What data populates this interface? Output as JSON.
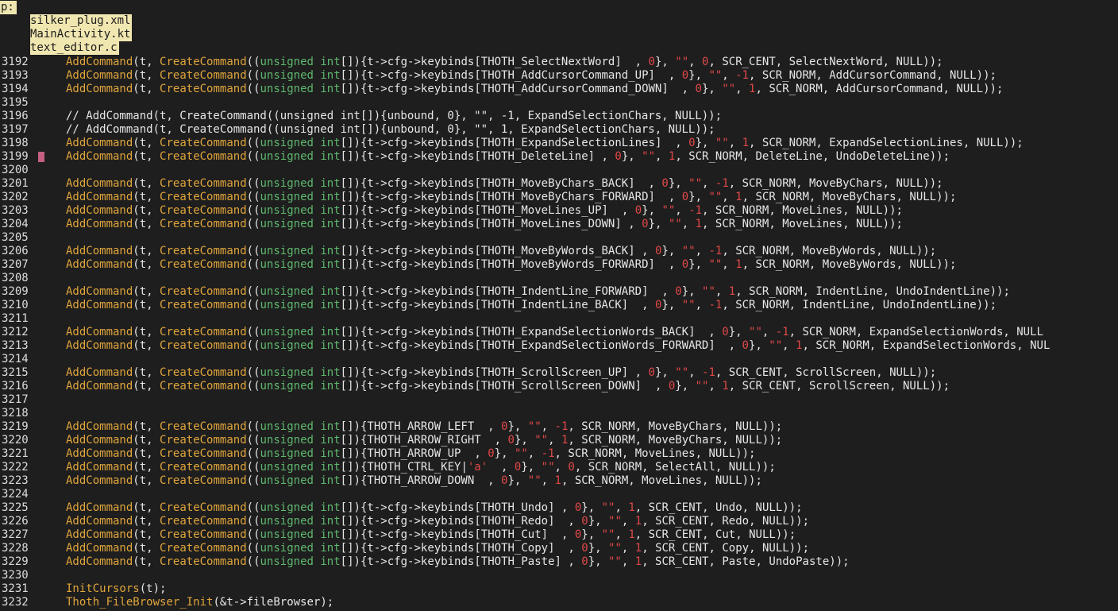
{
  "prompt": {
    "label": "p:"
  },
  "suggestions": [
    "silker_plug.xml",
    "MainActivity.kt",
    "text_editor.c"
  ],
  "colors": {
    "background": "#1e1e1e",
    "text": "#e6e6e6",
    "function": "#e0a53c",
    "type": "#5fb86e",
    "number": "#e04848",
    "suggestion_bg": "#f0e6b0",
    "line_marker": "#c46083"
  },
  "lines": [
    {
      "num": "3192",
      "code": "AddCommand(t, CreateCommand((unsigned int[]){t->cfg->keybinds[THOTH_SelectNextWord]  , 0}, \"\", 0, SCR_CENT, SelectNextWord, NULL));"
    },
    {
      "num": "3193",
      "code": "AddCommand(t, CreateCommand((unsigned int[]){t->cfg->keybinds[THOTH_AddCursorCommand_UP]  , 0}, \"\", -1, SCR_NORM, AddCursorCommand, NULL));"
    },
    {
      "num": "3194",
      "code": "AddCommand(t, CreateCommand((unsigned int[]){t->cfg->keybinds[THOTH_AddCursorCommand_DOWN]  , 0}, \"\", 1, SCR_NORM, AddCursorCommand, NULL));"
    },
    {
      "num": "3195",
      "code": ""
    },
    {
      "num": "3196",
      "code": "// AddCommand(t, CreateCommand((unsigned int[]){unbound, 0}, \"\", -1, ExpandSelectionChars, NULL));"
    },
    {
      "num": "3197",
      "code": "// AddCommand(t, CreateCommand((unsigned int[]){unbound, 0}, \"\", 1, ExpandSelectionChars, NULL));"
    },
    {
      "num": "3198",
      "code": "AddCommand(t, CreateCommand((unsigned int[]){t->cfg->keybinds[THOTH_ExpandSelectionLines]  , 0}, \"\", 1, SCR_NORM, ExpandSelectionLines, NULL));"
    },
    {
      "num": "3199",
      "code": "AddCommand(t, CreateCommand((unsigned int[]){t->cfg->keybinds[THOTH_DeleteLine] , 0}, \"\", 1, SCR_NORM, DeleteLine, UndoDeleteLine));",
      "marker": true
    },
    {
      "num": "3200",
      "code": ""
    },
    {
      "num": "3201",
      "code": "AddCommand(t, CreateCommand((unsigned int[]){t->cfg->keybinds[THOTH_MoveByChars_BACK]  , 0}, \"\", -1, SCR_NORM, MoveByChars, NULL));"
    },
    {
      "num": "3202",
      "code": "AddCommand(t, CreateCommand((unsigned int[]){t->cfg->keybinds[THOTH_MoveByChars_FORWARD]  , 0}, \"\", 1, SCR_NORM, MoveByChars, NULL));"
    },
    {
      "num": "3203",
      "code": "AddCommand(t, CreateCommand((unsigned int[]){t->cfg->keybinds[THOTH_MoveLines_UP]  , 0}, \"\", -1, SCR_NORM, MoveLines, NULL));"
    },
    {
      "num": "3204",
      "code": "AddCommand(t, CreateCommand((unsigned int[]){t->cfg->keybinds[THOTH_MoveLines_DOWN] , 0}, \"\", 1, SCR_NORM, MoveLines, NULL));"
    },
    {
      "num": "3205",
      "code": ""
    },
    {
      "num": "3206",
      "code": "AddCommand(t, CreateCommand((unsigned int[]){t->cfg->keybinds[THOTH_MoveByWords_BACK] , 0}, \"\", -1, SCR_NORM, MoveByWords, NULL));"
    },
    {
      "num": "3207",
      "code": "AddCommand(t, CreateCommand((unsigned int[]){t->cfg->keybinds[THOTH_MoveByWords_FORWARD]  , 0}, \"\", 1, SCR_NORM, MoveByWords, NULL));"
    },
    {
      "num": "3208",
      "code": ""
    },
    {
      "num": "3209",
      "code": "AddCommand(t, CreateCommand((unsigned int[]){t->cfg->keybinds[THOTH_IndentLine_FORWARD]  , 0}, \"\", 1, SCR_NORM, IndentLine, UndoIndentLine));"
    },
    {
      "num": "3210",
      "code": "AddCommand(t, CreateCommand((unsigned int[]){t->cfg->keybinds[THOTH_IndentLine_BACK]  , 0}, \"\", -1, SCR_NORM, IndentLine, UndoIndentLine));"
    },
    {
      "num": "3211",
      "code": ""
    },
    {
      "num": "3212",
      "code": "AddCommand(t, CreateCommand((unsigned int[]){t->cfg->keybinds[THOTH_ExpandSelectionWords_BACK]  , 0}, \"\", -1, SCR_NORM, ExpandSelectionWords, NULL"
    },
    {
      "num": "3213",
      "code": "AddCommand(t, CreateCommand((unsigned int[]){t->cfg->keybinds[THOTH_ExpandSelectionWords_FORWARD]  , 0}, \"\", 1, SCR_NORM, ExpandSelectionWords, NUL"
    },
    {
      "num": "3214",
      "code": ""
    },
    {
      "num": "3215",
      "code": "AddCommand(t, CreateCommand((unsigned int[]){t->cfg->keybinds[THOTH_ScrollScreen_UP] , 0}, \"\", -1, SCR_CENT, ScrollScreen, NULL));"
    },
    {
      "num": "3216",
      "code": "AddCommand(t, CreateCommand((unsigned int[]){t->cfg->keybinds[THOTH_ScrollScreen_DOWN]  , 0}, \"\", 1, SCR_CENT, ScrollScreen, NULL));"
    },
    {
      "num": "3217",
      "code": ""
    },
    {
      "num": "3218",
      "code": ""
    },
    {
      "num": "3219",
      "code": "AddCommand(t, CreateCommand((unsigned int[]){THOTH_ARROW_LEFT  , 0}, \"\", -1, SCR_NORM, MoveByChars, NULL));"
    },
    {
      "num": "3220",
      "code": "AddCommand(t, CreateCommand((unsigned int[]){THOTH_ARROW_RIGHT  , 0}, \"\", 1, SCR_NORM, MoveByChars, NULL));"
    },
    {
      "num": "3221",
      "code": "AddCommand(t, CreateCommand((unsigned int[]){THOTH_ARROW_UP  , 0}, \"\", -1, SCR_NORM, MoveLines, NULL));"
    },
    {
      "num": "3222",
      "code": "AddCommand(t, CreateCommand((unsigned int[]){THOTH_CTRL_KEY|'a'  , 0}, \"\", 0, SCR_NORM, SelectAll, NULL));"
    },
    {
      "num": "3223",
      "code": "AddCommand(t, CreateCommand((unsigned int[]){THOTH_ARROW_DOWN  , 0}, \"\", 1, SCR_NORM, MoveLines, NULL));"
    },
    {
      "num": "3224",
      "code": ""
    },
    {
      "num": "3225",
      "code": "AddCommand(t, CreateCommand((unsigned int[]){t->cfg->keybinds[THOTH_Undo] , 0}, \"\", 1, SCR_CENT, Undo, NULL));"
    },
    {
      "num": "3226",
      "code": "AddCommand(t, CreateCommand((unsigned int[]){t->cfg->keybinds[THOTH_Redo]  , 0}, \"\", 1, SCR_CENT, Redo, NULL));"
    },
    {
      "num": "3227",
      "code": "AddCommand(t, CreateCommand((unsigned int[]){t->cfg->keybinds[THOTH_Cut]  , 0}, \"\", 1, SCR_CENT, Cut, NULL));"
    },
    {
      "num": "3228",
      "code": "AddCommand(t, CreateCommand((unsigned int[]){t->cfg->keybinds[THOTH_Copy]  , 0}, \"\", 1, SCR_CENT, Copy, NULL));"
    },
    {
      "num": "3229",
      "code": "AddCommand(t, CreateCommand((unsigned int[]){t->cfg->keybinds[THOTH_Paste] , 0}, \"\", 1, SCR_CENT, Paste, UndoPaste));"
    },
    {
      "num": "3230",
      "code": ""
    },
    {
      "num": "3231",
      "code": "InitCursors(t);"
    },
    {
      "num": "3232",
      "code": "Thoth_FileBrowser_Init(&t->fileBrowser);"
    }
  ]
}
